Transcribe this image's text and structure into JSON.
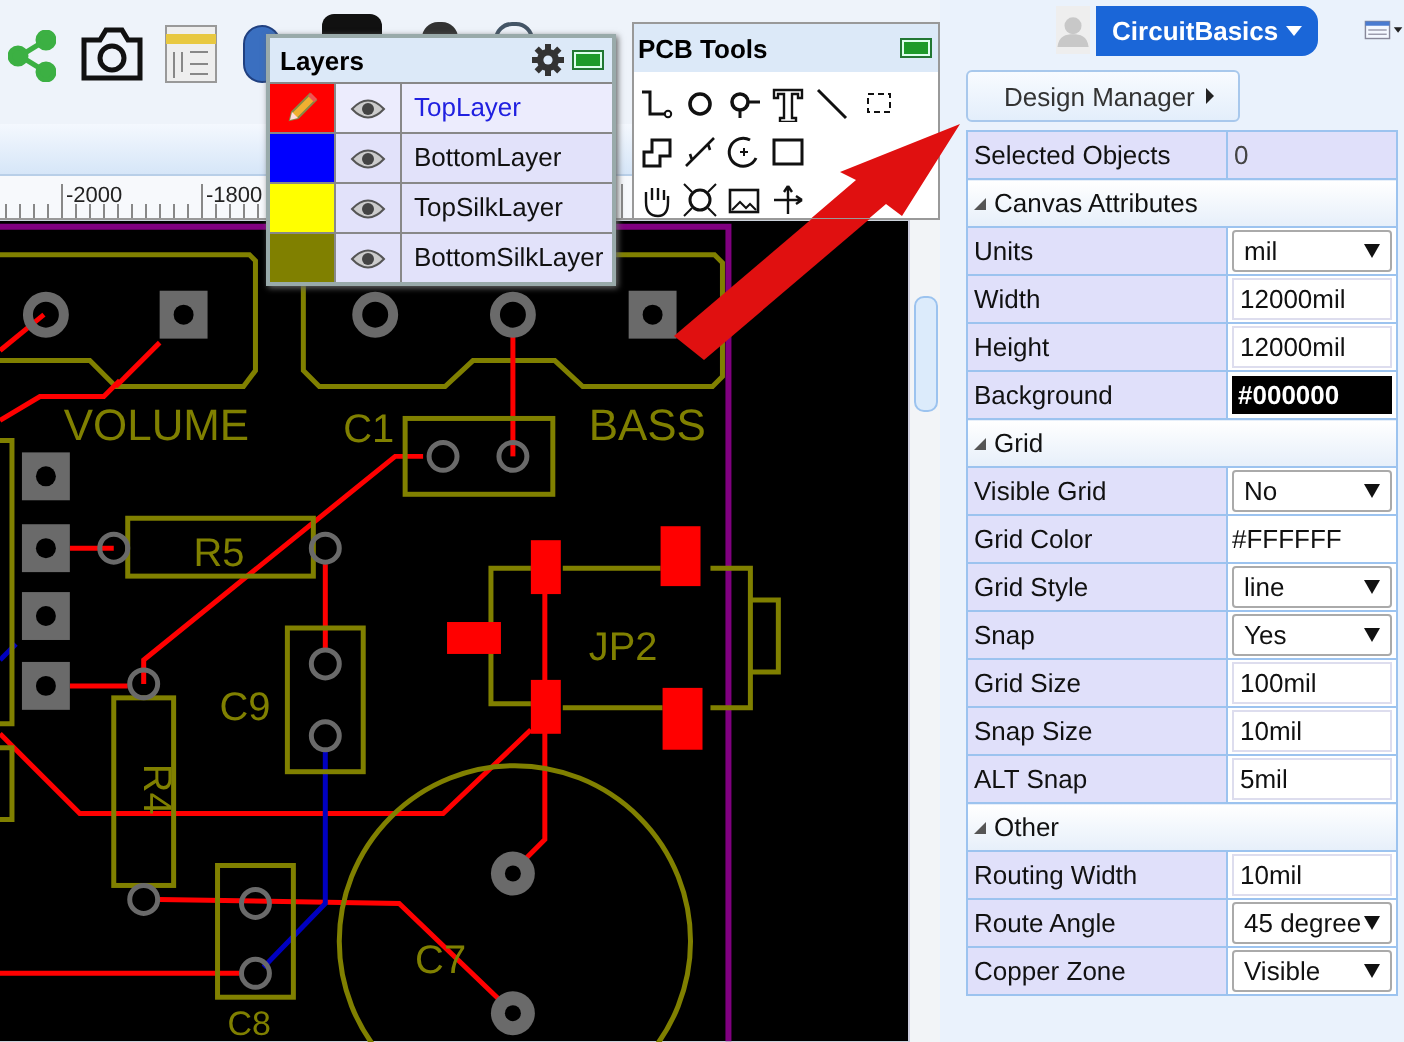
{
  "ruler": {
    "labels": [
      "-2000",
      "-1800"
    ]
  },
  "user": {
    "name": "CircuitBasics"
  },
  "layers_panel": {
    "title": "Layers",
    "layers": [
      {
        "name": "TopLayer",
        "color": "#ff0000",
        "selected": true
      },
      {
        "name": "BottomLayer",
        "color": "#0000ff",
        "selected": false
      },
      {
        "name": "TopSilkLayer",
        "color": "#ffff00",
        "selected": false
      },
      {
        "name": "BottomSilkLayer",
        "color": "#808000",
        "selected": false
      }
    ]
  },
  "tools_panel": {
    "title": "PCB Tools"
  },
  "design_manager": {
    "label": "Design Manager"
  },
  "properties": {
    "rows": [
      {
        "kind": "info",
        "label": "Selected Objects",
        "value": "0"
      },
      {
        "kind": "section",
        "label": "Canvas Attributes",
        "expanded": true
      },
      {
        "kind": "select",
        "label": "Units",
        "value": "mil"
      },
      {
        "kind": "input",
        "label": "Width",
        "value": "12000mil"
      },
      {
        "kind": "input",
        "label": "Height",
        "value": "12000mil"
      },
      {
        "kind": "color",
        "label": "Background",
        "value": "#000000"
      },
      {
        "kind": "section",
        "label": "Grid",
        "expanded": true
      },
      {
        "kind": "select",
        "label": "Visible Grid",
        "value": "No"
      },
      {
        "kind": "text",
        "label": "Grid Color",
        "value": "#FFFFFF"
      },
      {
        "kind": "select",
        "label": "Grid Style",
        "value": "line"
      },
      {
        "kind": "select",
        "label": "Snap",
        "value": "Yes"
      },
      {
        "kind": "input",
        "label": "Grid Size",
        "value": "100mil"
      },
      {
        "kind": "input",
        "label": "Snap Size",
        "value": "10mil"
      },
      {
        "kind": "input",
        "label": "ALT Snap",
        "value": "5mil"
      },
      {
        "kind": "section",
        "label": "Other",
        "expanded": true
      },
      {
        "kind": "input",
        "label": "Routing Width",
        "value": "10mil"
      },
      {
        "kind": "select",
        "label": "Route Angle",
        "value": "45 degree"
      },
      {
        "kind": "select",
        "label": "Copper Zone",
        "value": "Visible"
      }
    ]
  },
  "board": {
    "silk_labels": [
      "VOLUME",
      "C1",
      "BASS",
      "R5",
      "C9",
      "JP2",
      "R4",
      "C7",
      "C8"
    ]
  }
}
